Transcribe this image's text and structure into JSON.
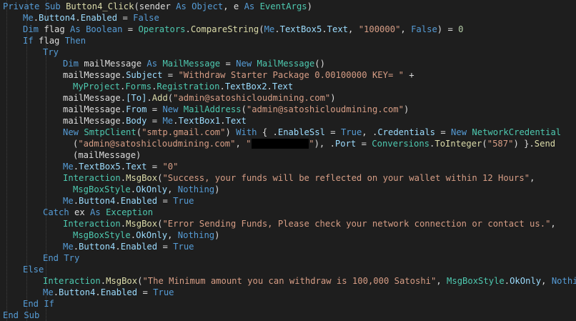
{
  "editor": {
    "lines": [
      {
        "indent": 0,
        "tokens": [
          [
            "kw",
            "Private Sub "
          ],
          [
            "fn",
            "Button4_Click"
          ],
          [
            "p",
            "(sender "
          ],
          [
            "kw",
            "As "
          ],
          [
            "kw",
            "Object"
          ],
          [
            "p",
            ", e "
          ],
          [
            "kw",
            "As "
          ],
          [
            "typ",
            "EventArgs"
          ],
          [
            "p",
            ")"
          ]
        ]
      },
      {
        "indent": 1,
        "tokens": [
          [
            "kw",
            "Me"
          ],
          [
            "p",
            "."
          ],
          [
            "mem",
            "Button4"
          ],
          [
            "p",
            "."
          ],
          [
            "mem",
            "Enabled"
          ],
          [
            "p",
            " = "
          ],
          [
            "kw",
            "False"
          ]
        ]
      },
      {
        "indent": 1,
        "tokens": [
          [
            "kw",
            "Dim "
          ],
          [
            "p",
            "flag "
          ],
          [
            "kw",
            "As "
          ],
          [
            "kw",
            "Boolean"
          ],
          [
            "p",
            " = "
          ],
          [
            "typ",
            "Operators"
          ],
          [
            "p",
            "."
          ],
          [
            "fn",
            "CompareString"
          ],
          [
            "p",
            "("
          ],
          [
            "kw",
            "Me"
          ],
          [
            "p",
            "."
          ],
          [
            "mem",
            "TextBox5"
          ],
          [
            "p",
            "."
          ],
          [
            "mem",
            "Text"
          ],
          [
            "p",
            ", "
          ],
          [
            "str",
            "\"100000\""
          ],
          [
            "p",
            ", "
          ],
          [
            "kw",
            "False"
          ],
          [
            "p",
            ") = "
          ],
          [
            "num",
            "0"
          ]
        ]
      },
      {
        "indent": 1,
        "tokens": [
          [
            "kw",
            "If "
          ],
          [
            "p",
            "flag "
          ],
          [
            "kw",
            "Then"
          ]
        ]
      },
      {
        "indent": 2,
        "tokens": [
          [
            "kw",
            "Try"
          ]
        ]
      },
      {
        "indent": 3,
        "tokens": [
          [
            "kw",
            "Dim "
          ],
          [
            "p",
            "mailMessage "
          ],
          [
            "kw",
            "As "
          ],
          [
            "typ",
            "MailMessage"
          ],
          [
            "p",
            " = "
          ],
          [
            "kw",
            "New "
          ],
          [
            "typ",
            "MailMessage"
          ],
          [
            "p",
            "()"
          ]
        ]
      },
      {
        "indent": 3,
        "tokens": [
          [
            "p",
            "mailMessage."
          ],
          [
            "mem",
            "Subject"
          ],
          [
            "p",
            " = "
          ],
          [
            "str",
            "\"Withdraw Starter Package 0.00100000 KEY= \""
          ],
          [
            "p",
            " +"
          ]
        ]
      },
      {
        "indent": 3.5,
        "tokens": [
          [
            "typ",
            "MyProject"
          ],
          [
            "p",
            "."
          ],
          [
            "typ",
            "Forms"
          ],
          [
            "p",
            "."
          ],
          [
            "typ",
            "Registration"
          ],
          [
            "p",
            "."
          ],
          [
            "mem",
            "TextBox2"
          ],
          [
            "p",
            "."
          ],
          [
            "mem",
            "Text"
          ]
        ]
      },
      {
        "indent": 3,
        "tokens": [
          [
            "p",
            "mailMessage."
          ],
          [
            "mem",
            "[To]"
          ],
          [
            "p",
            "."
          ],
          [
            "fn",
            "Add"
          ],
          [
            "p",
            "("
          ],
          [
            "str",
            "\"admin@satoshicloudmining.com\""
          ],
          [
            "p",
            ")"
          ]
        ]
      },
      {
        "indent": 3,
        "tokens": [
          [
            "p",
            "mailMessage."
          ],
          [
            "mem",
            "From"
          ],
          [
            "p",
            " = "
          ],
          [
            "kw",
            "New "
          ],
          [
            "typ",
            "MailAddress"
          ],
          [
            "p",
            "("
          ],
          [
            "str",
            "\"admin@satoshicloudmining.com\""
          ],
          [
            "p",
            ")"
          ]
        ]
      },
      {
        "indent": 3,
        "tokens": [
          [
            "p",
            "mailMessage."
          ],
          [
            "mem",
            "Body"
          ],
          [
            "p",
            " = "
          ],
          [
            "kw",
            "Me"
          ],
          [
            "p",
            "."
          ],
          [
            "mem",
            "TextBox1"
          ],
          [
            "p",
            "."
          ],
          [
            "mem",
            "Text"
          ]
        ]
      },
      {
        "indent": 3,
        "tokens": [
          [
            "kw",
            "New "
          ],
          [
            "typ",
            "SmtpClient"
          ],
          [
            "p",
            "("
          ],
          [
            "str",
            "\"smtp.gmail.com\""
          ],
          [
            "p",
            ") "
          ],
          [
            "kw",
            "With "
          ],
          [
            "p",
            "{ ."
          ],
          [
            "mem",
            "EnableSsl"
          ],
          [
            "p",
            " = "
          ],
          [
            "kw",
            "True"
          ],
          [
            "p",
            ", ."
          ],
          [
            "mem",
            "Credentials"
          ],
          [
            "p",
            " = "
          ],
          [
            "kw",
            "New "
          ],
          [
            "typ",
            "NetworkCredential"
          ]
        ]
      },
      {
        "indent": 3.5,
        "tokens": [
          [
            "p",
            "("
          ],
          [
            "str",
            "\"admin@satoshicloudmining.com\""
          ],
          [
            "p",
            ", "
          ],
          [
            "str",
            "\""
          ],
          [
            "redact",
            "xxxxxxxxxxx"
          ],
          [
            "str",
            "\""
          ],
          [
            "p",
            "), ."
          ],
          [
            "mem",
            "Port"
          ],
          [
            "p",
            " = "
          ],
          [
            "typ",
            "Conversions"
          ],
          [
            "p",
            "."
          ],
          [
            "fn",
            "ToInteger"
          ],
          [
            "p",
            "("
          ],
          [
            "str",
            "\"587\""
          ],
          [
            "p",
            ") }."
          ],
          [
            "fn",
            "Send"
          ]
        ]
      },
      {
        "indent": 3.5,
        "tokens": [
          [
            "p",
            "(mailMessage)"
          ]
        ]
      },
      {
        "indent": 3,
        "tokens": [
          [
            "kw",
            "Me"
          ],
          [
            "p",
            "."
          ],
          [
            "mem",
            "TextBox5"
          ],
          [
            "p",
            "."
          ],
          [
            "mem",
            "Text"
          ],
          [
            "p",
            " = "
          ],
          [
            "str",
            "\"0\""
          ]
        ]
      },
      {
        "indent": 3,
        "tokens": [
          [
            "typ",
            "Interaction"
          ],
          [
            "p",
            "."
          ],
          [
            "fn",
            "MsgBox"
          ],
          [
            "p",
            "("
          ],
          [
            "str",
            "\"Success, your funds will be reflected on your wallet within 12 Hours\""
          ],
          [
            "p",
            ","
          ]
        ]
      },
      {
        "indent": 3.5,
        "tokens": [
          [
            "typ",
            "MsgBoxStyle"
          ],
          [
            "p",
            "."
          ],
          [
            "mem",
            "OkOnly"
          ],
          [
            "p",
            ", "
          ],
          [
            "kw",
            "Nothing"
          ],
          [
            "p",
            ")"
          ]
        ]
      },
      {
        "indent": 3,
        "tokens": [
          [
            "kw",
            "Me"
          ],
          [
            "p",
            "."
          ],
          [
            "mem",
            "Button4"
          ],
          [
            "p",
            "."
          ],
          [
            "mem",
            "Enabled"
          ],
          [
            "p",
            " = "
          ],
          [
            "kw",
            "True"
          ]
        ]
      },
      {
        "indent": 2,
        "tokens": [
          [
            "kw",
            "Catch "
          ],
          [
            "p",
            "ex "
          ],
          [
            "kw",
            "As "
          ],
          [
            "typ",
            "Exception"
          ]
        ]
      },
      {
        "indent": 3,
        "tokens": [
          [
            "typ",
            "Interaction"
          ],
          [
            "p",
            "."
          ],
          [
            "fn",
            "MsgBox"
          ],
          [
            "p",
            "("
          ],
          [
            "str",
            "\"Error Sending Funds, Please check your network connection or contact us.\""
          ],
          [
            "p",
            ","
          ]
        ]
      },
      {
        "indent": 3.5,
        "tokens": [
          [
            "typ",
            "MsgBoxStyle"
          ],
          [
            "p",
            "."
          ],
          [
            "mem",
            "OkOnly"
          ],
          [
            "p",
            ", "
          ],
          [
            "kw",
            "Nothing"
          ],
          [
            "p",
            ")"
          ]
        ]
      },
      {
        "indent": 3,
        "tokens": [
          [
            "kw",
            "Me"
          ],
          [
            "p",
            "."
          ],
          [
            "mem",
            "Button4"
          ],
          [
            "p",
            "."
          ],
          [
            "mem",
            "Enabled"
          ],
          [
            "p",
            " = "
          ],
          [
            "kw",
            "True"
          ]
        ]
      },
      {
        "indent": 2,
        "tokens": [
          [
            "kw",
            "End Try"
          ]
        ]
      },
      {
        "indent": 1,
        "tokens": [
          [
            "kw",
            "Else"
          ]
        ]
      },
      {
        "indent": 2,
        "tokens": [
          [
            "typ",
            "Interaction"
          ],
          [
            "p",
            "."
          ],
          [
            "fn",
            "MsgBox"
          ],
          [
            "p",
            "("
          ],
          [
            "str",
            "\"The Minimum amount you can withdraw is 100,000 Satoshi\""
          ],
          [
            "p",
            ", "
          ],
          [
            "typ",
            "MsgBoxStyle"
          ],
          [
            "p",
            "."
          ],
          [
            "mem",
            "OkOnly"
          ],
          [
            "p",
            ", "
          ],
          [
            "kw",
            "Nothing"
          ],
          [
            "p",
            ")"
          ]
        ]
      },
      {
        "indent": 2,
        "tokens": [
          [
            "kw",
            "Me"
          ],
          [
            "p",
            "."
          ],
          [
            "mem",
            "Button4"
          ],
          [
            "p",
            "."
          ],
          [
            "mem",
            "Enabled"
          ],
          [
            "p",
            " = "
          ],
          [
            "kw",
            "True"
          ]
        ]
      },
      {
        "indent": 1,
        "tokens": [
          [
            "kw",
            "End If"
          ]
        ]
      },
      {
        "indent": 0,
        "tokens": [
          [
            "kw",
            "End Sub"
          ]
        ]
      }
    ]
  }
}
